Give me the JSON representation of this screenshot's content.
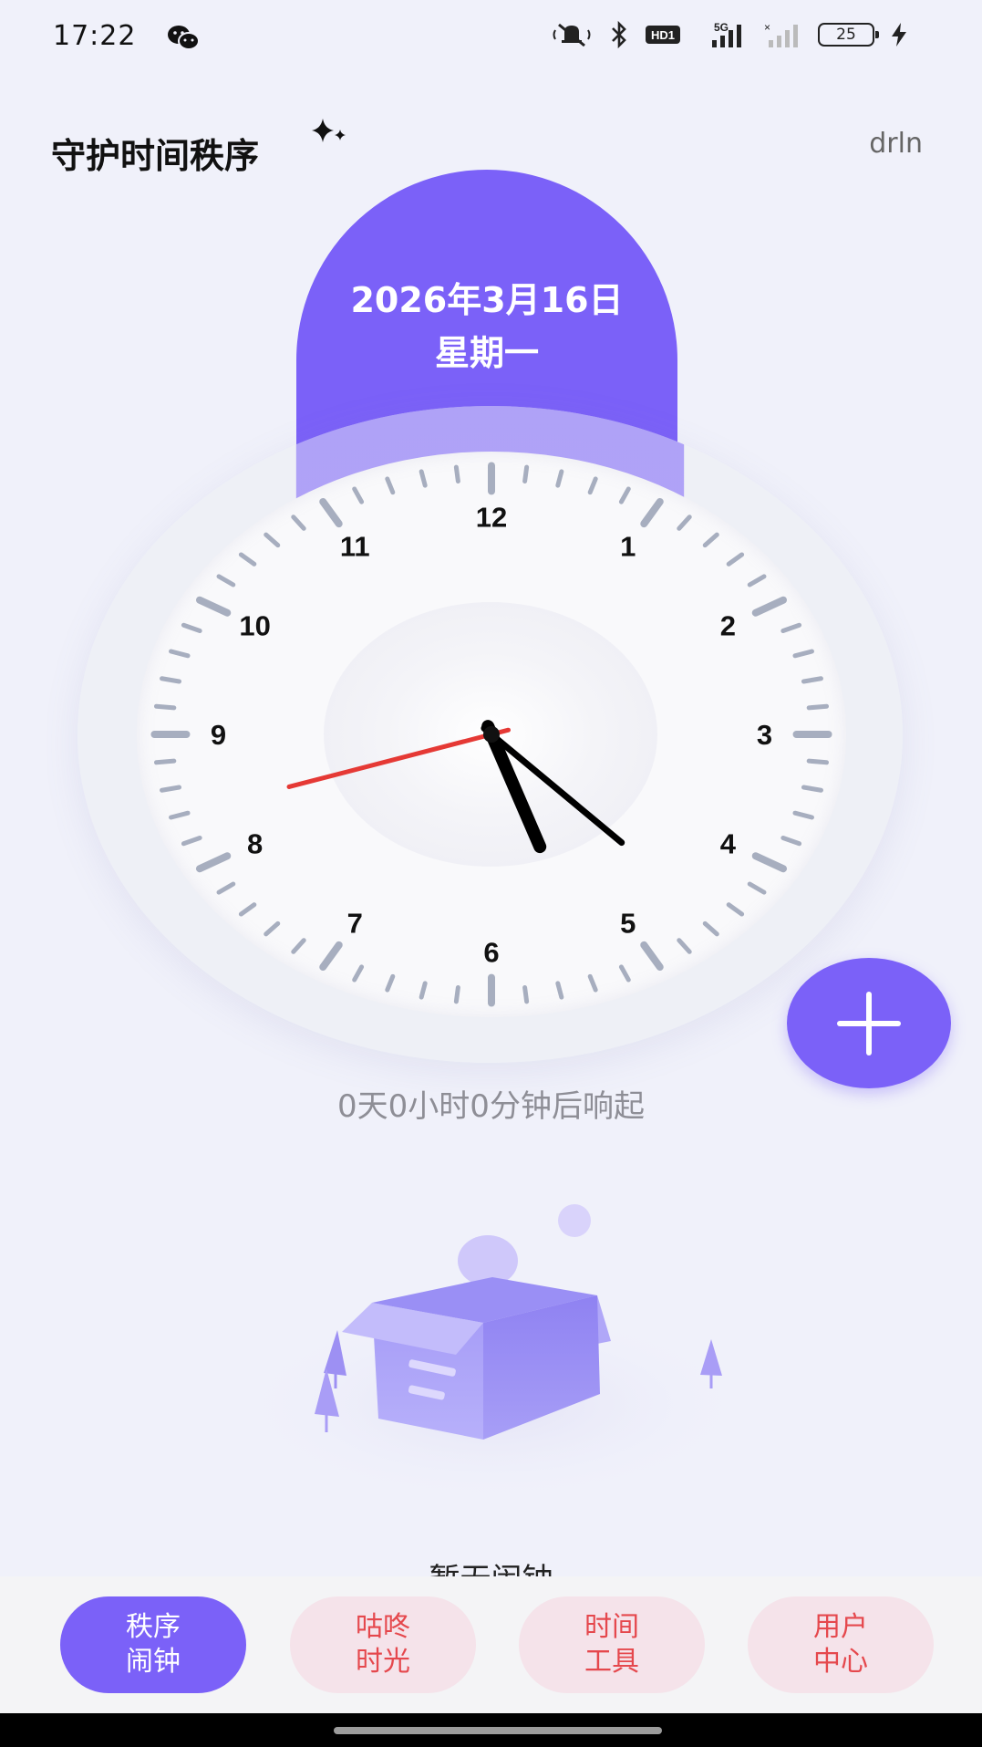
{
  "status_bar": {
    "time": "17:22",
    "battery": "25",
    "network": "5G",
    "hd_label": "HD1",
    "icons": [
      "wechat-icon",
      "mute-icon",
      "bluetooth-icon",
      "hd-icon",
      "signal-5g-icon",
      "signal-no-service-icon",
      "battery-icon",
      "charging-icon"
    ]
  },
  "header": {
    "title": "守护时间秩序",
    "user": "drln"
  },
  "date": {
    "line1": "2026年3月16日",
    "line2": "星期一"
  },
  "clock": {
    "numbers": [
      "12",
      "1",
      "2",
      "3",
      "4",
      "5",
      "6",
      "7",
      "8",
      "9",
      "10",
      "11"
    ],
    "hour": 5,
    "minute": 22,
    "second": 42,
    "colors": {
      "hour_hand": "#000000",
      "minute_hand": "#000000",
      "second_hand": "#e53935",
      "ticks": "#a7aebf"
    }
  },
  "countdown": "0天0小时0分钟后响起",
  "empty_state": {
    "text": "暂无闹钟"
  },
  "tabs": [
    {
      "line1": "秩序",
      "line2": "闹钟",
      "active": true
    },
    {
      "line1": "咕咚",
      "line2": "时光",
      "active": false
    },
    {
      "line1": "时间",
      "line2": "工具",
      "active": false
    },
    {
      "line1": "用户",
      "line2": "中心",
      "active": false
    }
  ],
  "colors": {
    "accent": "#7b61f8",
    "inactive_tab_bg": "#f5e3ea",
    "inactive_tab_text": "#e5484d",
    "background": "#f0f1fa"
  }
}
